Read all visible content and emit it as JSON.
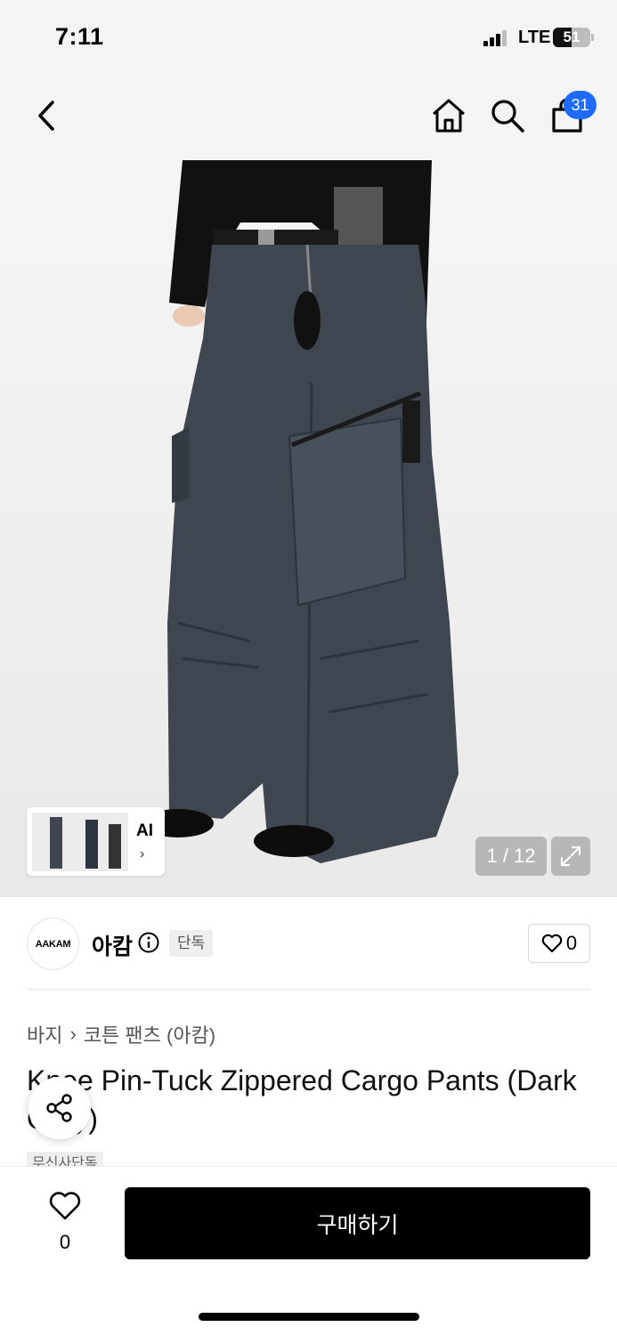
{
  "status_bar": {
    "time": "7:11",
    "network": "LTE",
    "battery": "51"
  },
  "nav": {
    "back_icon": "chevron-left-icon",
    "home_icon": "home-icon",
    "search_icon": "search-icon",
    "cart_icon": "shopping-bag-icon",
    "cart_count": "31"
  },
  "gallery": {
    "ai_label": "AI",
    "counter": "1 / 12",
    "expand_icon": "expand-icon",
    "image_description": "Dark gray wide-leg cargo pants with zippered pocket"
  },
  "brand": {
    "logo_text": "AAKAM",
    "name": "아캄",
    "badge": "단독",
    "like_count": "0"
  },
  "breadcrumb": {
    "category": "바지",
    "separator": "›",
    "subcategory": "코튼 팬츠 (아캄)"
  },
  "product": {
    "title": "Knee Pin-Tuck Zippered Cargo Pants (Dark Gray)",
    "tag": "무신사단독"
  },
  "bottom_bar": {
    "wish_count": "0",
    "buy_label": "구매하기"
  },
  "colors": {
    "accent_badge": "#1f6bff",
    "buy_button": "#000000",
    "pants": "#3f4650"
  }
}
